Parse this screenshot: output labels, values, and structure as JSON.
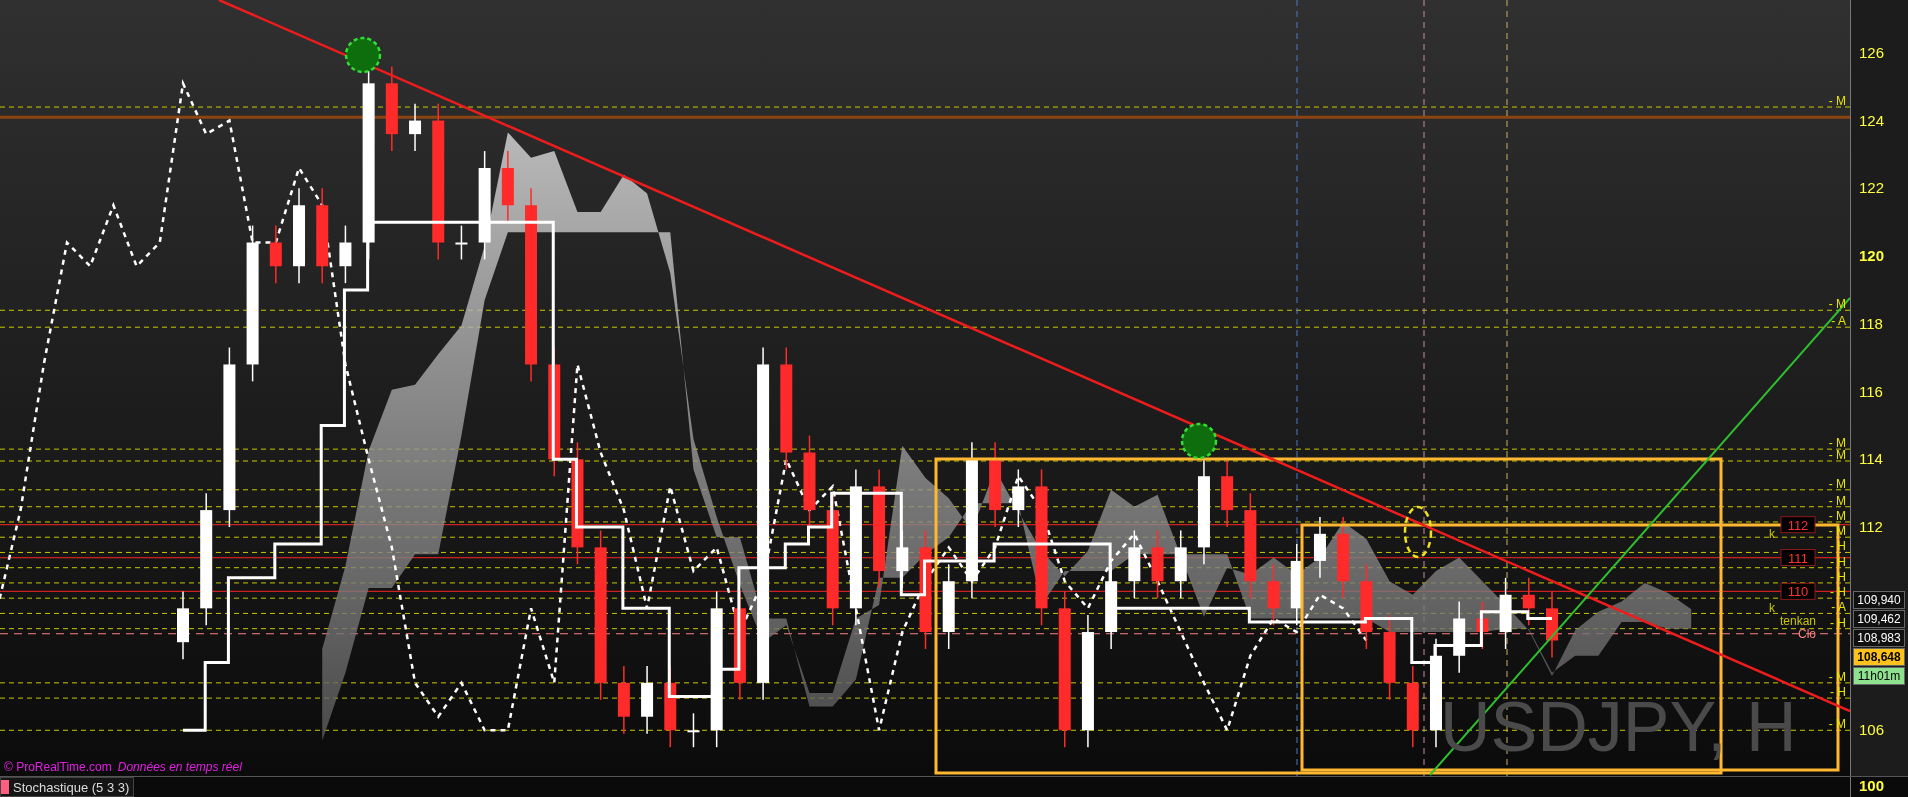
{
  "chart": {
    "symbol": "USDJPY, H",
    "source": "© ProRealTime.com",
    "notice": "Données en temps réel",
    "level_labels": [
      "- M",
      "- M",
      "- A",
      "- M",
      "- M",
      "- M",
      "- M",
      "- M",
      "- M",
      "- H",
      "- H",
      "- H",
      "- H",
      "- A",
      "- H",
      "- M",
      "- H",
      "- M"
    ],
    "line_labels": [
      {
        "text": "112",
        "kind": "tag"
      },
      {
        "text": "111",
        "kind": "tag"
      },
      {
        "text": "110",
        "kind": "tag"
      },
      {
        "text": "k",
        "kind": "short"
      },
      {
        "text": "k",
        "kind": "short"
      },
      {
        "text": "tenkan",
        "kind": "name"
      },
      {
        "text": "Clo",
        "kind": "close"
      }
    ],
    "price_axis": [
      {
        "text": "126",
        "bold": false
      },
      {
        "text": "124",
        "bold": false
      },
      {
        "text": "122",
        "bold": false
      },
      {
        "text": "120",
        "bold": true
      },
      {
        "text": "118",
        "bold": false
      },
      {
        "text": "116",
        "bold": false
      },
      {
        "text": "114",
        "bold": false
      },
      {
        "text": "112",
        "bold": false
      },
      {
        "text": "106",
        "bold": false
      }
    ],
    "price_tags": [
      {
        "text": "109,940",
        "kind": "level"
      },
      {
        "text": "109,462",
        "kind": "level"
      },
      {
        "text": "108,983",
        "kind": "level"
      },
      {
        "text": "108,648",
        "kind": "last"
      },
      {
        "text": "11h01m",
        "kind": "timer"
      }
    ]
  },
  "indicator_panel": {
    "label": "Stochastique (5 3 3)",
    "color": "#ff5f7f",
    "axis_label": "100"
  }
}
